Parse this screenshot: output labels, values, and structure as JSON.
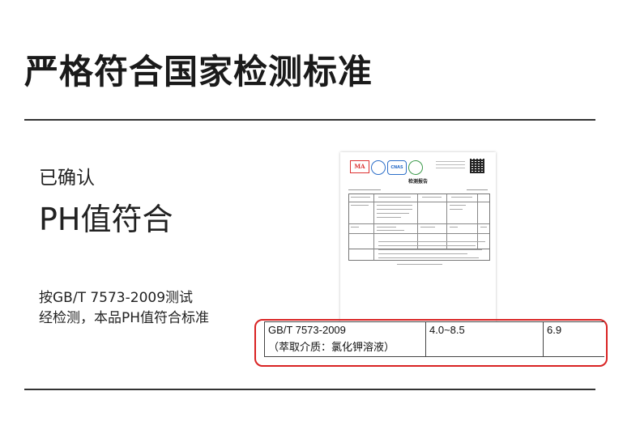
{
  "headline": "严格符合国家检测标准",
  "left_panel": {
    "confirmed": "已确认",
    "ph_title": "PH值符合",
    "note_line1": "按GB/T 7573-2009测试",
    "note_line2": "经检测，本品PH值符合标准"
  },
  "report": {
    "title": "检测报告",
    "logo_ma": "MA",
    "logo_cnas": "CNAS"
  },
  "highlight_row": {
    "standard": "GB/T 7573-2009",
    "medium": "（萃取介质：氯化钾溶液）",
    "range": "4.0~8.5",
    "result": "6.9"
  },
  "colors": {
    "highlight_border": "#d92323",
    "rule": "#333333"
  }
}
